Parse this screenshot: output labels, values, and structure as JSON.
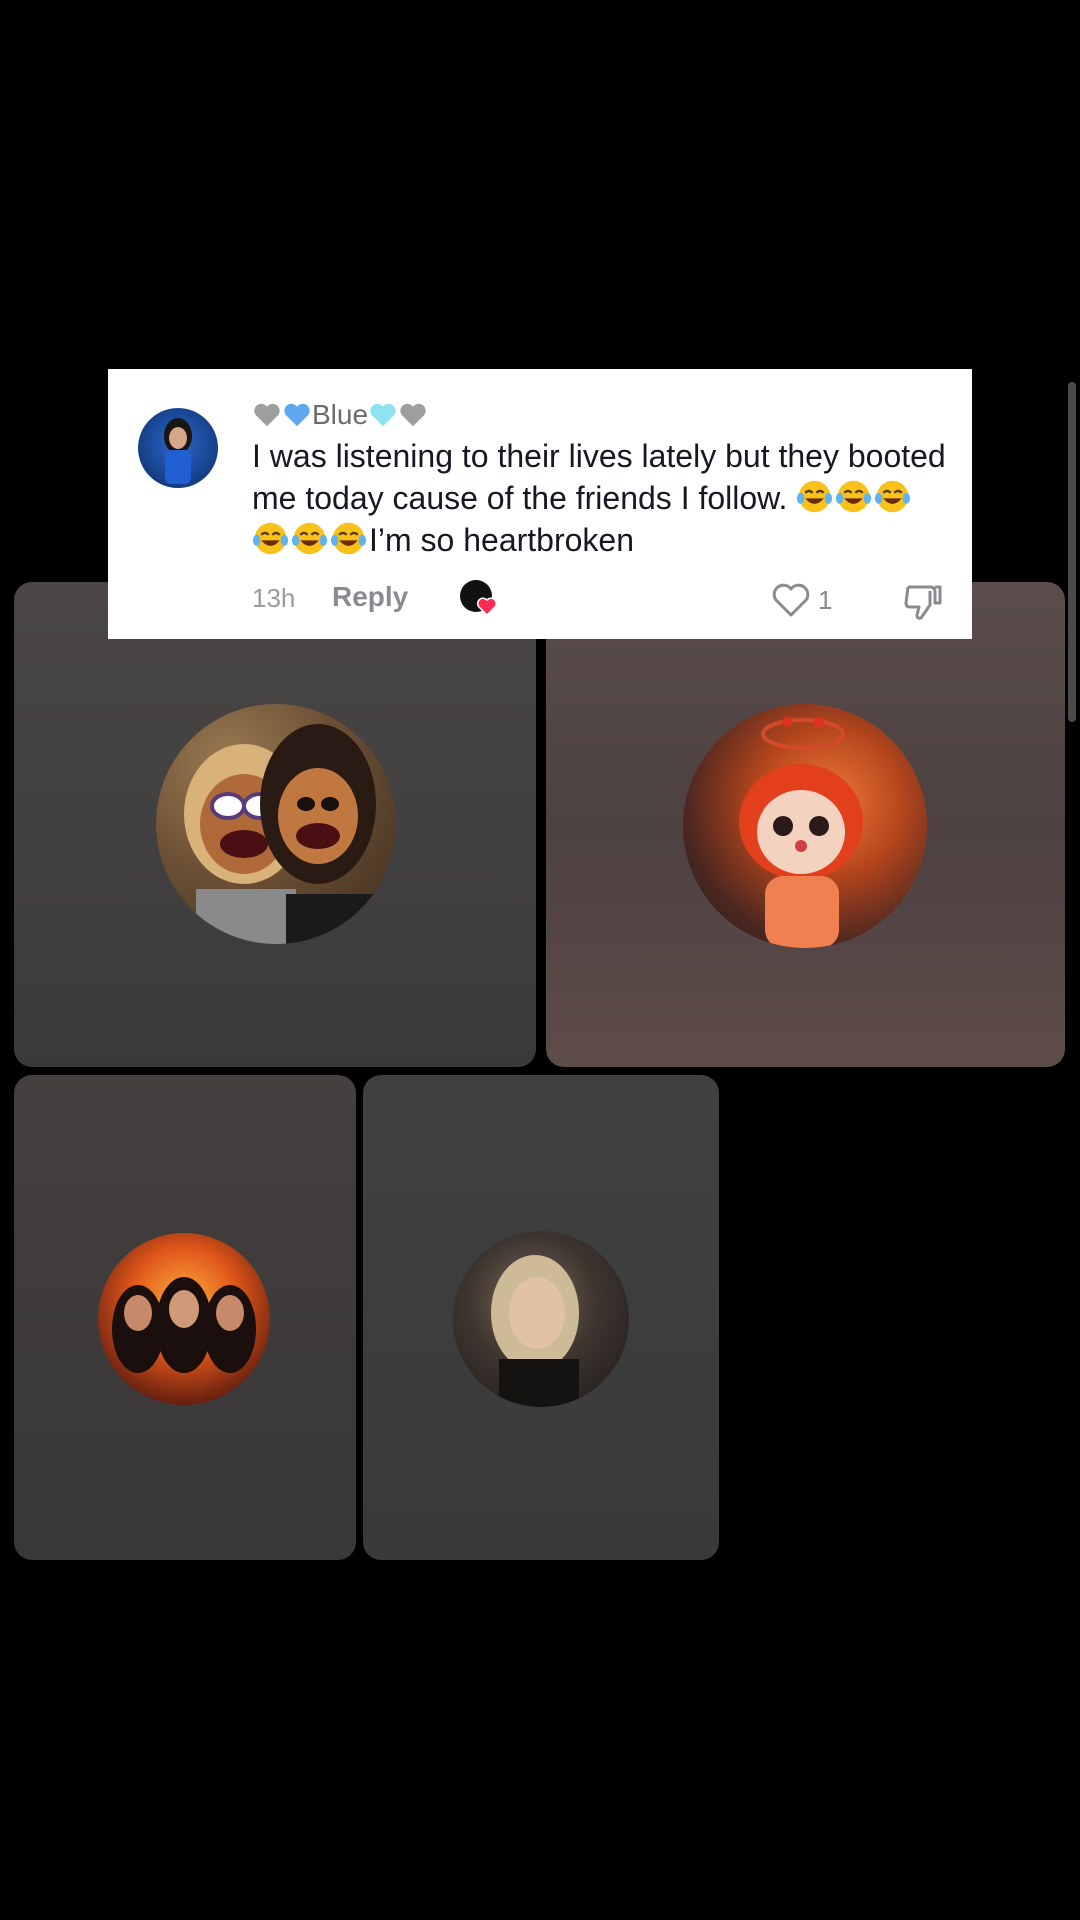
{
  "comment": {
    "username_prefix_icons": [
      "grey-heart",
      "blue-heart"
    ],
    "username": "Blue",
    "username_suffix_icons": [
      "light-blue-heart",
      "grey-heart"
    ],
    "text_part1": "I was listening to their lives lately but they booted me today cause of the friends I follow. ",
    "emojis": [
      "face-with-tears-of-joy",
      "face-with-tears-of-joy",
      "face-with-tears-of-joy",
      "face-with-tears-of-joy",
      "face-with-tears-of-joy",
      "face-with-tears-of-joy"
    ],
    "text_part2": "I’m so heartbroken",
    "time": "13h",
    "reply_label": "Reply",
    "like_count": "1"
  },
  "colors": {
    "card_bg": "#ffffff",
    "text_primary": "#161823",
    "text_secondary": "#8a8b91",
    "creator_heart": "#fe2c55",
    "page_bg": "#000000"
  },
  "live_grid": {
    "tiles": [
      {
        "avatar": "two-puppet-women-avatar"
      },
      {
        "avatar": "red-haired-girl-in-fire-avatar"
      },
      {
        "avatar": "three-women-in-fire-avatar"
      },
      {
        "avatar": "blonde-woman-dark-avatar"
      }
    ]
  }
}
